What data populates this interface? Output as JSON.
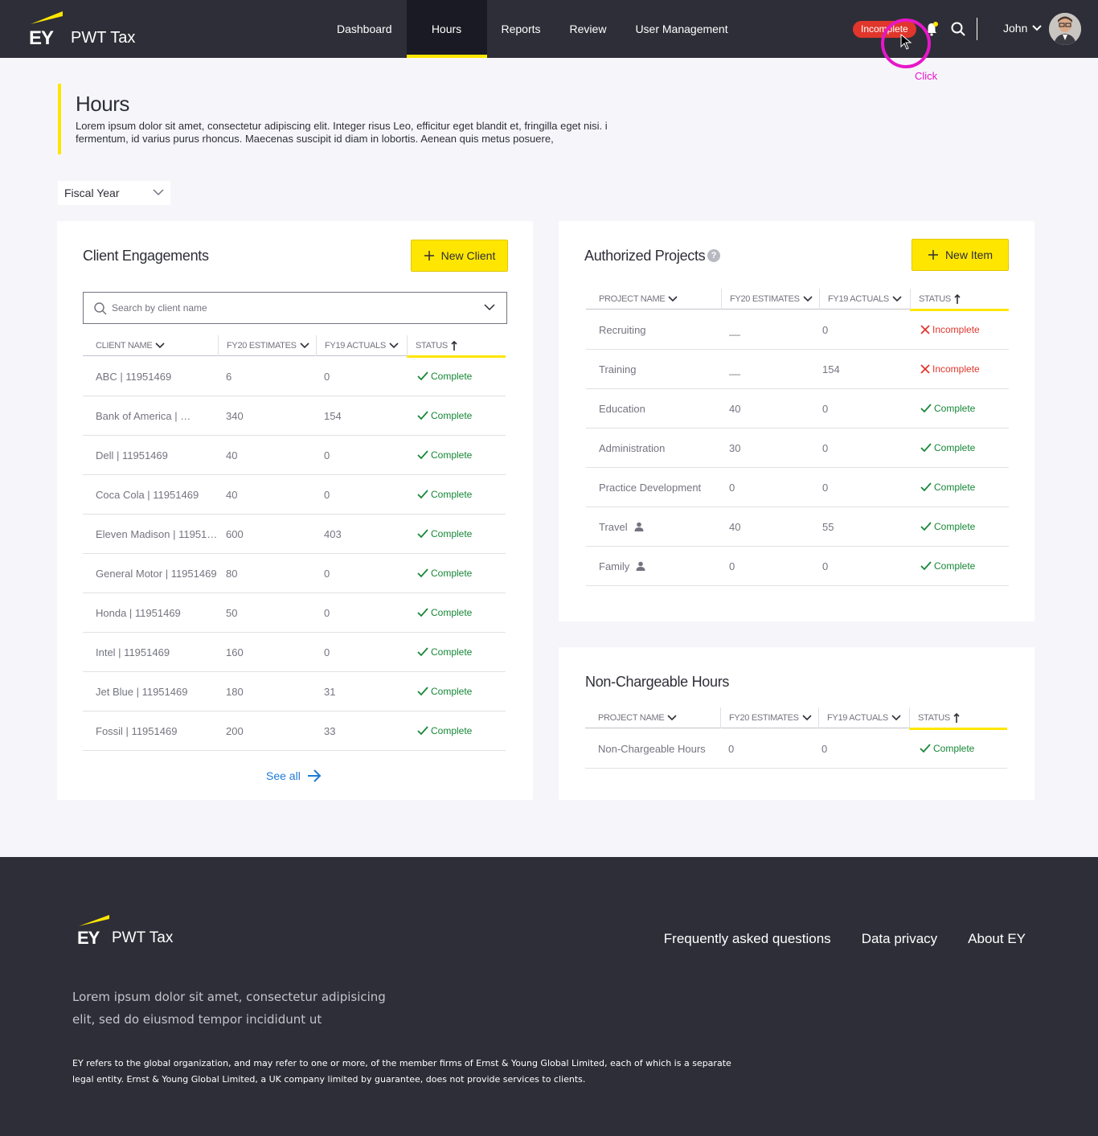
{
  "header": {
    "logo_text": "EY",
    "app_name": "PWT Tax",
    "nav": [
      "Dashboard",
      "Hours",
      "Reports",
      "Review",
      "User Management"
    ],
    "active_nav": "Hours",
    "status_pill": "Incomplete",
    "user_name": "John",
    "click_label": "Click"
  },
  "page": {
    "title": "Hours",
    "description": "Lorem ipsum dolor sit amet, consectetur adipiscing elit. Integer risus Leo, efficitur eget blandit et, fringilla eget nisi. i fermentum, id varius purus rhoncus. Maecenas suscipit id diam in lobortis. Aenean quis metus posuere,",
    "fiscal_year_label": "Fiscal Year"
  },
  "client_engagements": {
    "title": "Client Engagements",
    "new_button": "New Client",
    "search_placeholder": "Search by client name",
    "columns": [
      "CLIENT NAME",
      "FY20 ESTIMATES",
      "FY19 ACTUALS",
      "STATUS"
    ],
    "rows": [
      {
        "name": "ABC | 11951469",
        "fy20": "6",
        "fy19": "0",
        "status": "Complete"
      },
      {
        "name": "Bank of America | …",
        "fy20": "340",
        "fy19": "154",
        "status": "Complete"
      },
      {
        "name": "Dell | 11951469",
        "fy20": "40",
        "fy19": "0",
        "status": "Complete"
      },
      {
        "name": "Coca Cola | 11951469",
        "fy20": "40",
        "fy19": "0",
        "status": "Complete"
      },
      {
        "name": "Eleven Madison | 11951…",
        "fy20": "600",
        "fy19": "403",
        "status": "Complete"
      },
      {
        "name": "General Motor | 11951469",
        "fy20": "80",
        "fy19": "0",
        "status": "Complete"
      },
      {
        "name": "Honda | 11951469",
        "fy20": "50",
        "fy19": "0",
        "status": "Complete"
      },
      {
        "name": "Intel | 11951469",
        "fy20": "160",
        "fy19": "0",
        "status": "Complete"
      },
      {
        "name": "Jet Blue | 11951469",
        "fy20": "180",
        "fy19": "31",
        "status": "Complete"
      },
      {
        "name": "Fossil | 11951469",
        "fy20": "200",
        "fy19": "33",
        "status": "Complete"
      }
    ],
    "see_all": "See all"
  },
  "authorized_projects": {
    "title": "Authorized Projects",
    "help": "?",
    "new_button": "New Item",
    "columns": [
      "PROJECT NAME",
      "FY20 ESTIMATES",
      "FY19 ACTUALS",
      "STATUS"
    ],
    "rows": [
      {
        "name": "Recruiting",
        "fy20": "__",
        "fy19": "0",
        "status": "Incomplete",
        "person": false
      },
      {
        "name": "Training",
        "fy20": "__",
        "fy19": "154",
        "status": "Incomplete",
        "person": false
      },
      {
        "name": "Education",
        "fy20": "40",
        "fy19": "0",
        "status": "Complete",
        "person": false
      },
      {
        "name": "Administration",
        "fy20": "30",
        "fy19": "0",
        "status": "Complete",
        "person": false
      },
      {
        "name": "Practice Development",
        "fy20": "0",
        "fy19": "0",
        "status": "Complete",
        "person": false
      },
      {
        "name": "Travel",
        "fy20": "40",
        "fy19": "55",
        "status": "Complete",
        "person": true
      },
      {
        "name": "Family",
        "fy20": "0",
        "fy19": "0",
        "status": "Complete",
        "person": true
      }
    ]
  },
  "non_chargeable": {
    "title": "Non-Chargeable Hours",
    "columns": [
      "PROJECT NAME",
      "FY20 ESTIMATES",
      "FY19 ACTUALS",
      "STATUS"
    ],
    "rows": [
      {
        "name": "Non-Chargeable Hours",
        "fy20": "0",
        "fy19": "0",
        "status": "Complete"
      }
    ]
  },
  "footer": {
    "logo_text": "EY",
    "app_name": "PWT Tax",
    "links": [
      "Frequently asked questions",
      "Data privacy",
      "About EY"
    ],
    "tagline": "Lorem ipsum dolor sit amet, consectetur adipisicing elit, sed do eiusmod tempor incididunt ut",
    "legal": "EY refers to the global organization, and may refer to one or more, of the member firms of Ernst & Young Global Limited, each of which is a separate legal entity. Ernst & Young Global Limited, a UK company limited by guarantee, does not provide services to clients."
  },
  "colors": {
    "brand_yellow": "#ffe600",
    "header_bg": "#2e2e38",
    "complete_green": "#168736",
    "incomplete_red": "#e0362c",
    "link_blue": "#1f7ad6",
    "click_magenta": "#e617c8"
  },
  "icons": [
    "ey-logo-bar",
    "bell-icon",
    "search-icon",
    "chevron-down-icon",
    "avatar",
    "plus-icon",
    "help-icon",
    "check-icon",
    "close-icon",
    "person-icon",
    "sort-up-icon",
    "arrow-right-icon",
    "cursor-icon"
  ]
}
